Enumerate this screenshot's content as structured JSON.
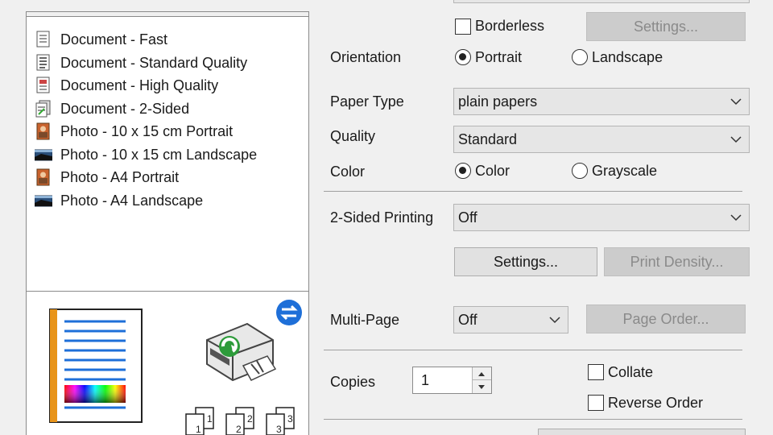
{
  "presets": [
    {
      "label": "Document - Fast",
      "icon": "document-fast-icon"
    },
    {
      "label": "Document - Standard Quality",
      "icon": "document-standard-icon"
    },
    {
      "label": "Document - High Quality",
      "icon": "document-high-quality-icon"
    },
    {
      "label": "Document - 2-Sided",
      "icon": "document-2-sided-icon"
    },
    {
      "label": "Photo - 10 x 15 cm Portrait",
      "icon": "photo-portrait-icon"
    },
    {
      "label": "Photo - 10 x 15 cm Landscape",
      "icon": "photo-landscape-icon"
    },
    {
      "label": "Photo - A4 Portrait",
      "icon": "photo-portrait-icon"
    },
    {
      "label": "Photo - A4 Landscape",
      "icon": "photo-landscape-icon"
    }
  ],
  "borderless": {
    "label": "Borderless",
    "checked": false,
    "settings_label": "Settings..."
  },
  "orientation": {
    "label": "Orientation",
    "portrait": "Portrait",
    "landscape": "Landscape",
    "selected": "Portrait"
  },
  "paper_type": {
    "label": "Paper Type",
    "value": "plain papers"
  },
  "quality": {
    "label": "Quality",
    "value": "Standard"
  },
  "color": {
    "label": "Color",
    "color_option": "Color",
    "grayscale_option": "Grayscale",
    "selected": "Color"
  },
  "two_sided": {
    "label": "2-Sided Printing",
    "value": "Off",
    "settings_label": "Settings...",
    "density_label": "Print Density..."
  },
  "multi_page": {
    "label": "Multi-Page",
    "value": "Off",
    "page_order_label": "Page Order..."
  },
  "copies": {
    "label": "Copies",
    "value": "1",
    "collate_label": "Collate",
    "reverse_label": "Reverse Order",
    "collate_checked": false,
    "reverse_checked": false
  },
  "collate_pages": [
    "1",
    "1",
    "2",
    "2",
    "3",
    "3"
  ],
  "colors": {
    "accent_blue": "#1e6fd8",
    "orange_edge": "#e8941a"
  }
}
